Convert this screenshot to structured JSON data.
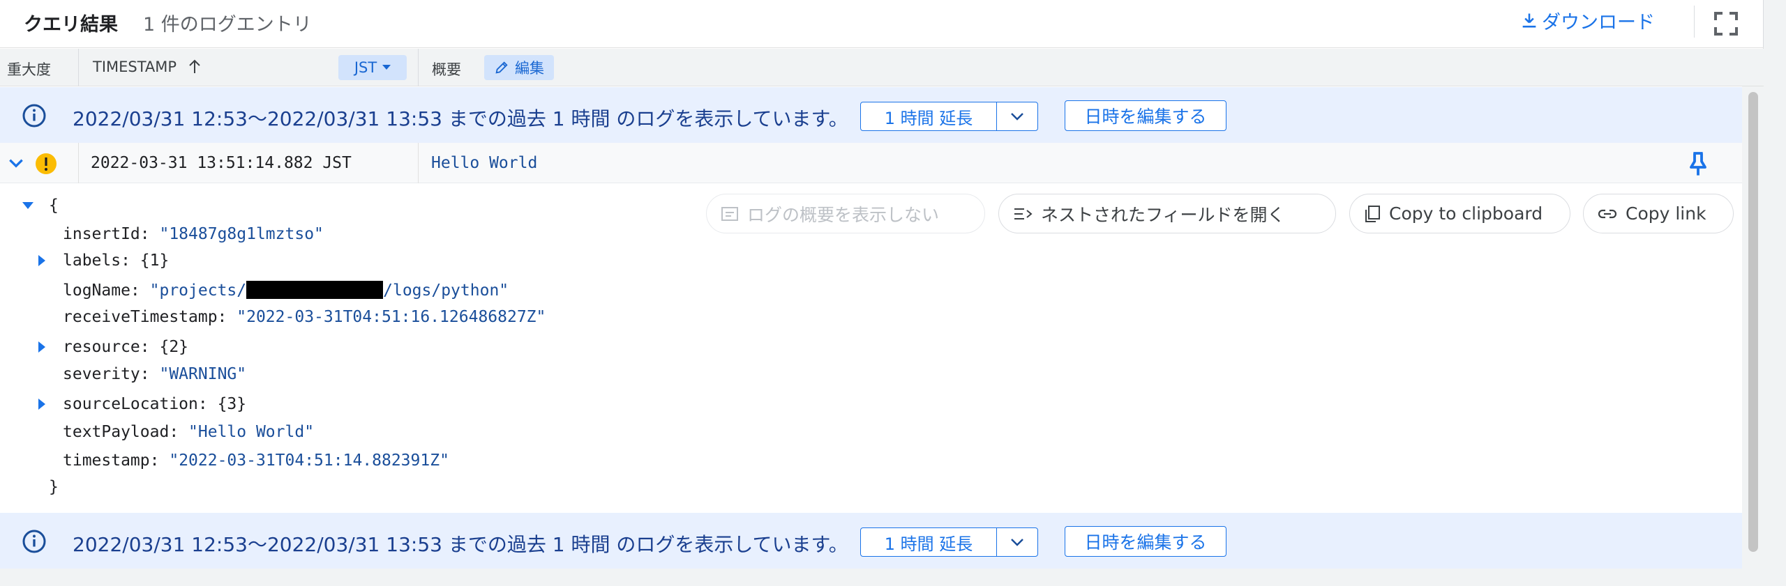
{
  "header": {
    "title": "クエリ結果",
    "count": "1 件のログエントリ",
    "download_label": "ダウンロード",
    "download_icon": "download-icon",
    "fullscreen_icon": "fullscreen-icon"
  },
  "columns": {
    "severity": "重大度",
    "timestamp": "TIMESTAMP",
    "timezone": "JST",
    "summary": "概要",
    "edit": "編集"
  },
  "banner": {
    "message": "2022/03/31 12:53～2022/03/31 13:53 までの過去 1 時間 のログを表示しています。",
    "extend_label": "1 時間 延長",
    "edit_datetime_label": "日時を編集する"
  },
  "entry": {
    "severity_icon": "warning-icon",
    "timestamp": "2022-03-31 13:51:14.882 JST",
    "summary": "Hello World"
  },
  "actions": {
    "hide_summary": "ログの概要を表示しない",
    "expand_nested": "ネストされたフィールドを開く",
    "copy_clipboard": "Copy to clipboard",
    "copy_link": "Copy link"
  },
  "json": {
    "open_brace": "{",
    "close_brace": "}",
    "insertId_key": "insertId:",
    "insertId_val": "\"18487g8g1lmztso\"",
    "labels_key": "labels:",
    "labels_val": "{1}",
    "logName_key": "logName:",
    "logName_prefix": "\"projects/",
    "logName_suffix": "/logs/python\"",
    "receiveTimestamp_key": "receiveTimestamp:",
    "receiveTimestamp_val": "\"2022-03-31T04:51:16.126486827Z\"",
    "resource_key": "resource:",
    "resource_val": "{2}",
    "severity_key": "severity:",
    "severity_val": "\"WARNING\"",
    "sourceLocation_key": "sourceLocation:",
    "sourceLocation_val": "{3}",
    "textPayload_key": "textPayload:",
    "textPayload_val": "\"Hello World\"",
    "timestamp_key": "timestamp:",
    "timestamp_val": "\"2022-03-31T04:51:14.882391Z\""
  },
  "colors": {
    "accent": "#1a73e8",
    "banner_bg": "#e8f0fe",
    "warning": "#fbbc04",
    "string_value": "#1a4e9a"
  }
}
